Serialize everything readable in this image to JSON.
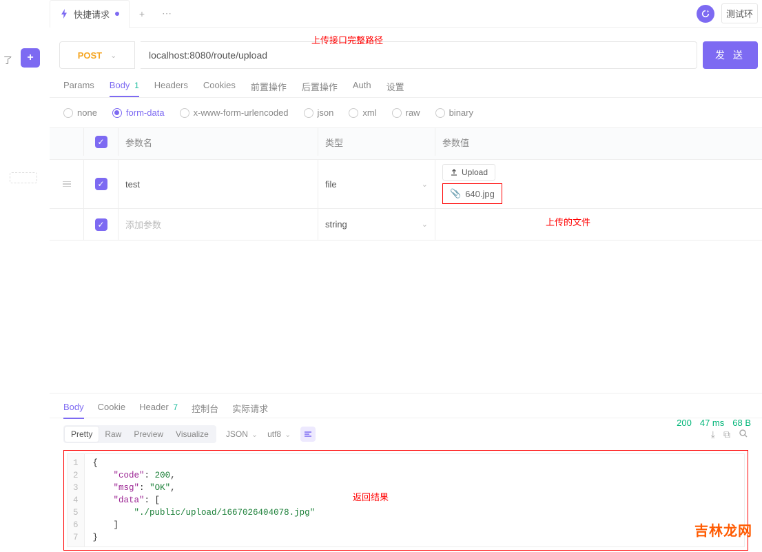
{
  "leftStrip": {
    "textFragment": "了"
  },
  "tabs": {
    "main": "快捷请求",
    "env": "测试环"
  },
  "annotations": {
    "urlPath": "上传接口完整路径",
    "uploadedFile": "上传的文件",
    "returnResult": "返回结果"
  },
  "request": {
    "method": "POST",
    "url": "localhost:8080/route/upload",
    "sendLabel": "发 送"
  },
  "subtabs": {
    "params": "Params",
    "body": "Body",
    "bodyBadge": "1",
    "headers": "Headers",
    "cookies": "Cookies",
    "pre": "前置操作",
    "post": "后置操作",
    "auth": "Auth",
    "settings": "设置"
  },
  "bodyTypes": {
    "none": "none",
    "formData": "form-data",
    "urlencoded": "x-www-form-urlencoded",
    "json": "json",
    "xml": "xml",
    "raw": "raw",
    "binary": "binary"
  },
  "paramsTable": {
    "headers": {
      "name": "参数名",
      "type": "类型",
      "value": "参数值"
    },
    "rows": [
      {
        "name": "test",
        "type": "file",
        "uploadLabel": "Upload",
        "fileName": "640.jpg"
      },
      {
        "name": "",
        "placeholder": "添加参数",
        "type": "string"
      }
    ]
  },
  "responseTabs": {
    "body": "Body",
    "cookie": "Cookie",
    "header": "Header",
    "headerBadge": "7",
    "console": "控制台",
    "actual": "实际请求"
  },
  "responseTools": {
    "pretty": "Pretty",
    "raw": "Raw",
    "preview": "Preview",
    "visualize": "Visualize",
    "format": "JSON",
    "encoding": "utf8"
  },
  "responseCode": {
    "lines": [
      "{",
      "    \"code\": 200,",
      "    \"msg\": \"OK\",",
      "    \"data\": [",
      "        \"./public/upload/1667026404078.jpg\"",
      "    ]",
      "}"
    ]
  },
  "status": {
    "code": "200",
    "time": "47 ms",
    "size": "68 B"
  },
  "watermark": "吉林龙网"
}
